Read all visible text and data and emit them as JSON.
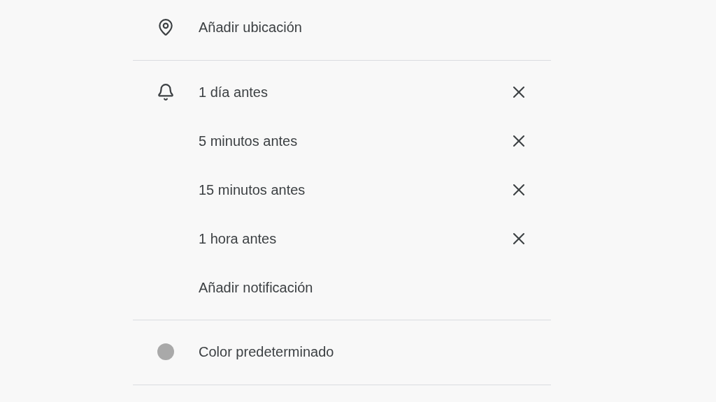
{
  "location": {
    "label": "Añadir ubicación"
  },
  "notifications": {
    "items": [
      {
        "label": "1 día antes"
      },
      {
        "label": "5 minutos antes"
      },
      {
        "label": "15 minutos antes"
      },
      {
        "label": "1 hora antes"
      }
    ],
    "add_label": "Añadir notificación"
  },
  "color": {
    "label": "Color predeterminado",
    "color": "#a9a9a9"
  }
}
